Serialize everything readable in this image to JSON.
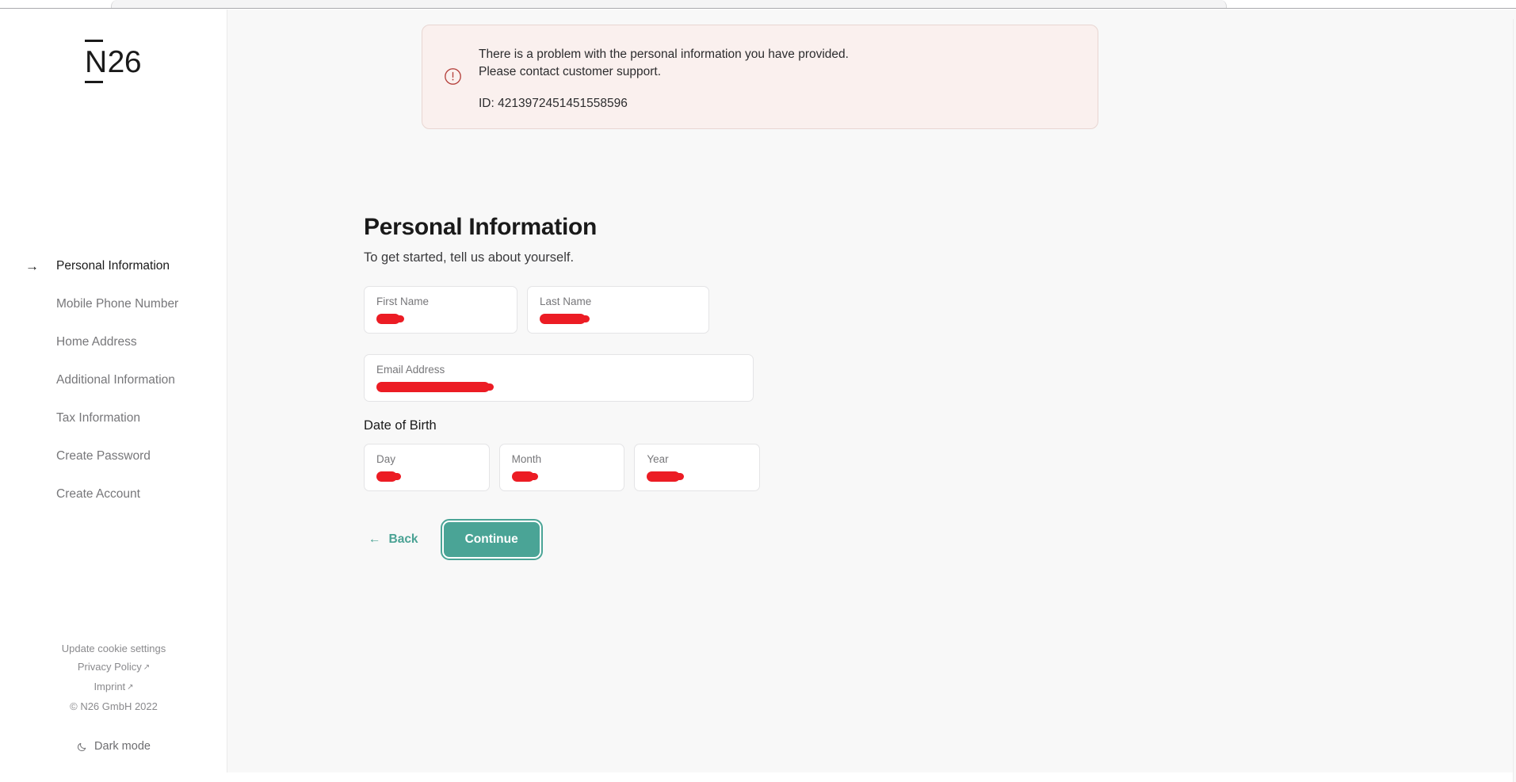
{
  "brand": {
    "logo_n": "N",
    "logo_rest": "26",
    "accent_teal": "#4aa496",
    "error_bg": "#faf0ee",
    "error_border": "#e8d6d2",
    "error_icon_color": "#b5413c",
    "redaction_color": "#ec1c24"
  },
  "alert": {
    "icon": "error-circle-icon",
    "line1": "There is a problem with the personal information you have provided.",
    "line2": "Please contact customer support.",
    "id_text": "ID: 4213972451451558596"
  },
  "sidebar": {
    "active_marker": "→",
    "items": [
      {
        "label": "Personal Information",
        "name": "sidebar-item-personal-information",
        "active": true
      },
      {
        "label": "Mobile Phone Number",
        "name": "sidebar-item-mobile-phone-number",
        "active": false
      },
      {
        "label": "Home Address",
        "name": "sidebar-item-home-address",
        "active": false
      },
      {
        "label": "Additional Information",
        "name": "sidebar-item-additional-information",
        "active": false
      },
      {
        "label": "Tax Information",
        "name": "sidebar-item-tax-information",
        "active": false
      },
      {
        "label": "Create Password",
        "name": "sidebar-item-create-password",
        "active": false
      },
      {
        "label": "Create Account",
        "name": "sidebar-item-create-account",
        "active": false
      }
    ],
    "footer": {
      "cookie_settings": "Update cookie settings",
      "privacy_policy": "Privacy Policy",
      "imprint": "Imprint",
      "external_arrow": "↗",
      "copyright": "© N26 GmbH 2022",
      "dark_mode": "Dark mode",
      "dark_mode_icon": "moon-icon"
    }
  },
  "main": {
    "title": "Personal Information",
    "subtitle": "To get started, tell us about yourself.",
    "dob_label": "Date of Birth",
    "fields": {
      "first_name": {
        "label": "First Name",
        "value": "",
        "redacted": true,
        "redact_width": 30
      },
      "last_name": {
        "label": "Last Name",
        "value": "",
        "redacted": true,
        "redact_width": 58
      },
      "email": {
        "label": "Email Address",
        "value": "",
        "redacted": true,
        "redact_width": 143
      },
      "day": {
        "label": "Day",
        "value": "",
        "redacted": true,
        "redact_width": 26
      },
      "month": {
        "label": "Month",
        "value": "",
        "redacted": true,
        "redact_width": 28
      },
      "year": {
        "label": "Year",
        "value": "",
        "redacted": true,
        "redact_width": 42
      }
    },
    "actions": {
      "back_label": "Back",
      "back_arrow": "←",
      "continue_label": "Continue"
    }
  }
}
